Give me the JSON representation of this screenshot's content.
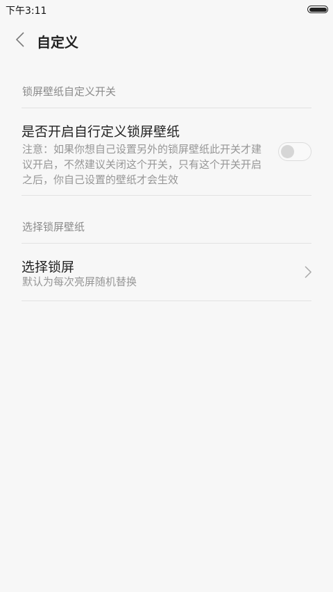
{
  "status_bar": {
    "time": "下午3:11"
  },
  "header": {
    "title": "自定义"
  },
  "sections": [
    {
      "header": "锁屏壁纸自定义开关",
      "item": {
        "title": "是否开启自行定义锁屏壁纸",
        "summary": "注意：如果你想自己设置另外的锁屏壁纸此开关才建议开启，不然建议关闭这个开关，只有这个开关开启之后，你自己设置的壁纸才会生效",
        "toggle_on": false
      }
    },
    {
      "header": "选择锁屏壁纸",
      "item": {
        "title": "选择锁屏",
        "summary": "默认为每次亮屏随机替换"
      }
    }
  ]
}
